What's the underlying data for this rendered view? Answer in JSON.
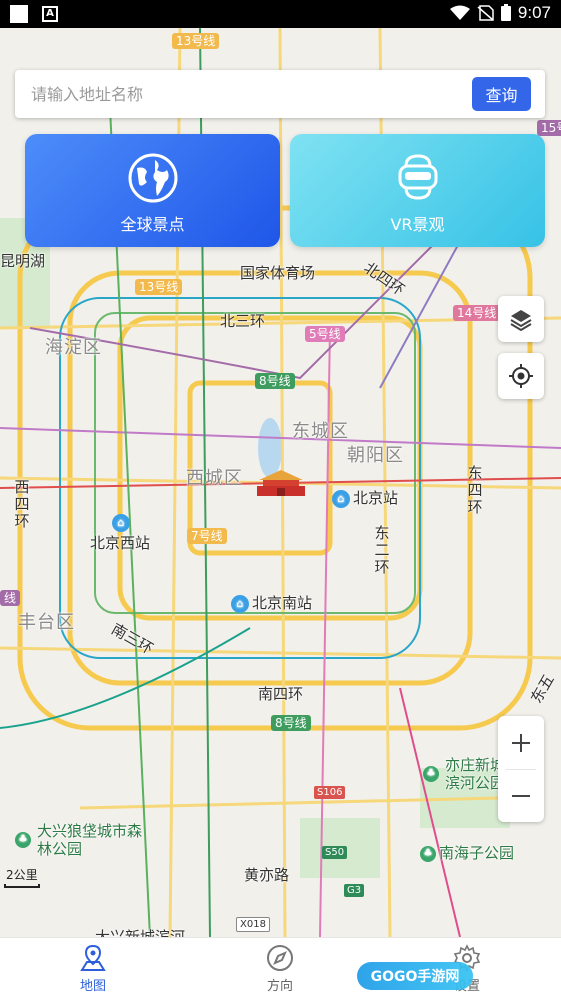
{
  "status_bar": {
    "time": "9:07"
  },
  "search": {
    "placeholder": "请输入地址名称",
    "button_label": "查询"
  },
  "cards": [
    {
      "label": "全球景点",
      "icon": "globe-icon"
    },
    {
      "label": "VR景观",
      "icon": "vr-headset-icon"
    }
  ],
  "map": {
    "districts": [
      "海淀区",
      "东城区",
      "朝阳区",
      "西城区",
      "丰台区"
    ],
    "roads": [
      "北三环",
      "北四环",
      "西四环",
      "东四环",
      "东二环",
      "南三环",
      "南四环",
      "黄亦路",
      "东五"
    ],
    "places": [
      "国家体育场",
      "北京站",
      "北京西站",
      "北京南站",
      "亦庄新城滨河公园",
      "大兴狼垡城市森林公园",
      "南海子公园",
      "昆明湖",
      "大兴新城滨河"
    ],
    "subway_lines": [
      "13号线",
      "13号线",
      "5号线",
      "8号线",
      "14号线",
      "7号线",
      "8号线",
      "15号",
      "线"
    ],
    "road_shields": [
      "S50",
      "G3",
      "X018",
      "S106"
    ],
    "scale": "2公里"
  },
  "nav": {
    "items": [
      {
        "label": "地图",
        "icon": "map-pin-icon",
        "active": true
      },
      {
        "label": "方向",
        "icon": "compass-icon",
        "active": false
      },
      {
        "label": "设置",
        "icon": "gear-icon",
        "active": false
      }
    ],
    "watermark": "GOGO手游网"
  },
  "colors": {
    "accent": "#3366e8",
    "card_blue": "#2b63ee",
    "card_cyan": "#4ccbe9",
    "nav_active": "#2c5fd9"
  }
}
